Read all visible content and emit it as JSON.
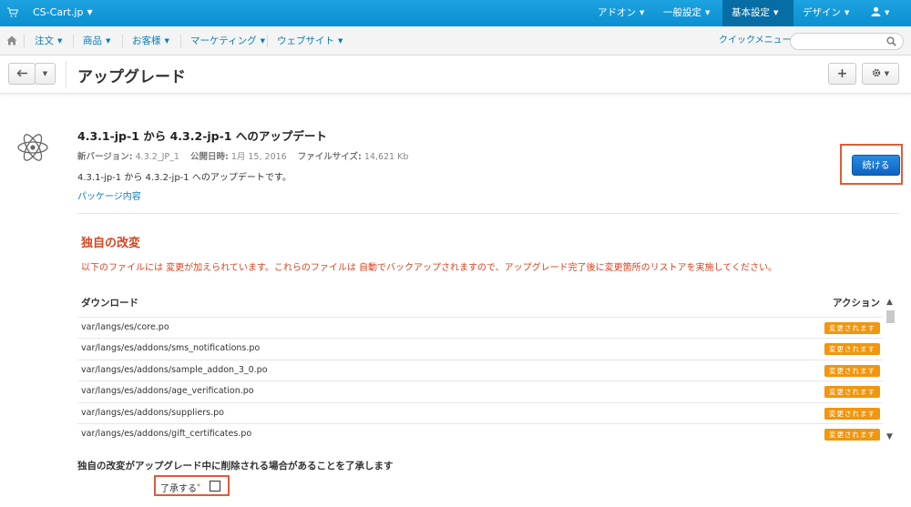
{
  "topbar": {
    "brand": "CS-Cart.jp",
    "menus": [
      "アドオン",
      "一般設定",
      "基本設定",
      "デザイン"
    ],
    "active_menu": "基本設定"
  },
  "nav": {
    "items": [
      "注文",
      "商品",
      "お客様",
      "マーケティング",
      "ウェブサイト"
    ],
    "quick_menu": "クイックメニュー",
    "search_placeholder": ""
  },
  "header": {
    "title": "アップグレード"
  },
  "upgrade": {
    "title": "4.3.1-jp-1 から 4.3.2-jp-1 へのアップデート",
    "new_version_label": "新バージョン:",
    "new_version": "4.3.2_JP_1",
    "release_date_label": "公開日時:",
    "release_date": "1月 15, 2016",
    "file_size_label": "ファイルサイズ:",
    "file_size": "14,621 Kb",
    "description": "4.3.1-jp-1 から 4.3.2-jp-1 へのアップデートです。",
    "package_link": "パッケージ内容",
    "continue_button": "続ける"
  },
  "custom_changes": {
    "title": "独自の改変",
    "description": "以下のファイルには 変更が加えられています。これらのファイルは 自動でバックアップされますので、アップグレード完了後に変更箇所のリストアを実施してください。",
    "columns": [
      "ダウンロード",
      "アクション"
    ],
    "rows": [
      {
        "path": "var/langs/es/core.po",
        "action": "変更されます"
      },
      {
        "path": "var/langs/es/addons/sms_notifications.po",
        "action": "変更されます"
      },
      {
        "path": "var/langs/es/addons/sample_addon_3_0.po",
        "action": "変更されます"
      },
      {
        "path": "var/langs/es/addons/age_verification.po",
        "action": "変更されます"
      },
      {
        "path": "var/langs/es/addons/suppliers.po",
        "action": "変更されます"
      },
      {
        "path": "var/langs/es/addons/gift_certificates.po",
        "action": "変更されます"
      }
    ]
  },
  "acknowledge": {
    "text": "独自の改変がアップグレード中に削除される場合があることを了承します",
    "label": "了承する",
    "required_mark": "*"
  },
  "colors": {
    "topbar": "#0a8fd0",
    "accent_red": "#d9431f",
    "badge_orange": "#f0960f",
    "primary_button": "#0b63c0"
  }
}
